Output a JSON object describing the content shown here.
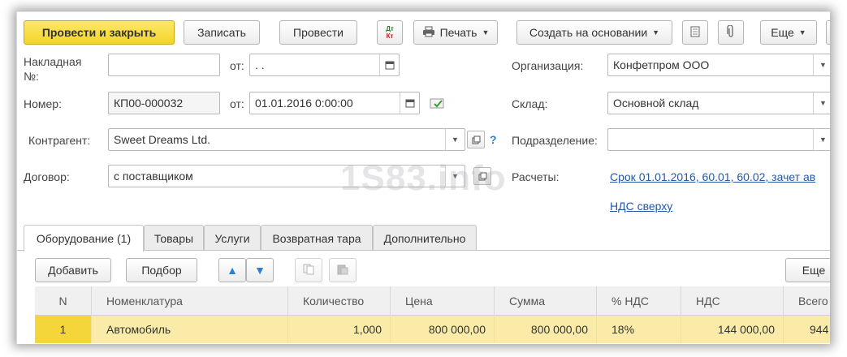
{
  "toolbar": {
    "post_close": "Провести и закрыть",
    "save": "Записать",
    "post": "Провести",
    "dtkt_top": "Дт",
    "dtkt_bottom": "Кт",
    "print": "Печать",
    "create_based": "Создать на основании",
    "more": "Еще"
  },
  "form": {
    "invoice_label": "Накладная №:",
    "invoice_no": "",
    "from_label": "от:",
    "invoice_date": " .  .",
    "number_label": "Номер:",
    "number": "КП00-000032",
    "from_label2": "от:",
    "date": "01.01.2016  0:00:00",
    "counterparty_label": "Контрагент:",
    "counterparty": "Sweet Dreams Ltd.",
    "help": "?",
    "contract_label": "Договор:",
    "contract": "с поставщиком",
    "org_label": "Организация:",
    "org": "Конфетпром ООО",
    "warehouse_label": "Склад:",
    "warehouse": "Основной склад",
    "division_label": "Подразделение:",
    "division": "",
    "settlements_label": "Расчеты:",
    "settlements_link": "Срок 01.01.2016, 60.01, 60.02, зачет ав",
    "vat_link": "НДС сверху"
  },
  "watermark": "1S83.info",
  "tabs": [
    {
      "label": "Оборудование (1)",
      "active": true
    },
    {
      "label": "Товары"
    },
    {
      "label": "Услуги"
    },
    {
      "label": "Возвратная тара"
    },
    {
      "label": "Дополнительно"
    }
  ],
  "table_toolbar": {
    "add": "Добавить",
    "select": "Подбор",
    "more": "Еще"
  },
  "table": {
    "headers": [
      "N",
      "Номенклатура",
      "Количество",
      "Цена",
      "Сумма",
      "% НДС",
      "НДС",
      "Всего"
    ],
    "rows": [
      [
        "1",
        "Автомобиль",
        "1,000",
        "800 000,00",
        "800 000,00",
        "18%",
        "144 000,00",
        "944"
      ]
    ]
  }
}
